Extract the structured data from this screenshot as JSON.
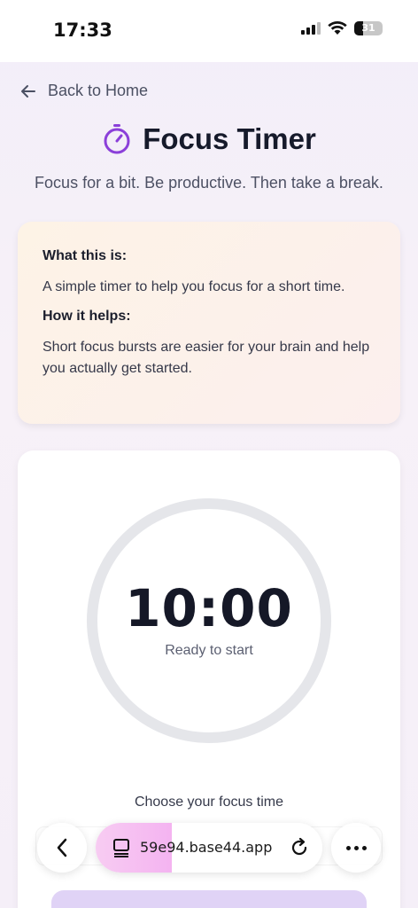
{
  "status_bar": {
    "time": "17:33",
    "battery": "31"
  },
  "nav": {
    "back_label": "Back to Home"
  },
  "header": {
    "title": "Focus Timer",
    "subtitle": "Focus for a bit. Be productive. Then take a break."
  },
  "info_card": {
    "what_heading": "What this is:",
    "what_text": "A simple timer to help you focus for a short time.",
    "how_heading": "How it helps:",
    "how_text": "Short focus bursts are easier for your brain and help you actually get started."
  },
  "timer": {
    "display": "10:00",
    "status": "Ready to start",
    "choose_label": "Choose your focus time"
  },
  "browser": {
    "url": "59e94.base44.app"
  },
  "colors": {
    "accent": "#8b3fd9",
    "ring": "#e5e6ea"
  }
}
